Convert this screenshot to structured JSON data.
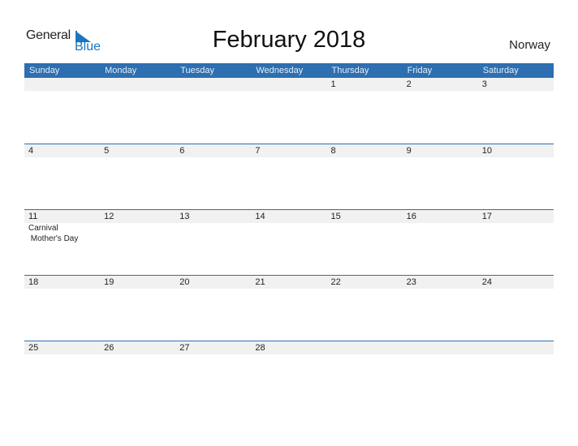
{
  "logo": {
    "general": "General",
    "blue": "Blue"
  },
  "title": "February 2018",
  "country": "Norway",
  "colors": {
    "accent": "#2d6fb0",
    "strip": "#f1f1f1",
    "logo_blue": "#1a76c2"
  },
  "weekdays": [
    "Sunday",
    "Monday",
    "Tuesday",
    "Wednesday",
    "Thursday",
    "Friday",
    "Saturday"
  ],
  "weeks": [
    {
      "days": [
        {
          "date": "",
          "events": []
        },
        {
          "date": "",
          "events": []
        },
        {
          "date": "",
          "events": []
        },
        {
          "date": "",
          "events": []
        },
        {
          "date": "1",
          "events": []
        },
        {
          "date": "2",
          "events": []
        },
        {
          "date": "3",
          "events": []
        }
      ]
    },
    {
      "days": [
        {
          "date": "4",
          "events": []
        },
        {
          "date": "5",
          "events": []
        },
        {
          "date": "6",
          "events": []
        },
        {
          "date": "7",
          "events": []
        },
        {
          "date": "8",
          "events": []
        },
        {
          "date": "9",
          "events": []
        },
        {
          "date": "10",
          "events": []
        }
      ]
    },
    {
      "days": [
        {
          "date": "11",
          "events": [
            "Carnival",
            " Mother's Day"
          ]
        },
        {
          "date": "12",
          "events": []
        },
        {
          "date": "13",
          "events": []
        },
        {
          "date": "14",
          "events": []
        },
        {
          "date": "15",
          "events": []
        },
        {
          "date": "16",
          "events": []
        },
        {
          "date": "17",
          "events": []
        }
      ]
    },
    {
      "days": [
        {
          "date": "18",
          "events": []
        },
        {
          "date": "19",
          "events": []
        },
        {
          "date": "20",
          "events": []
        },
        {
          "date": "21",
          "events": []
        },
        {
          "date": "22",
          "events": []
        },
        {
          "date": "23",
          "events": []
        },
        {
          "date": "24",
          "events": []
        }
      ]
    },
    {
      "days": [
        {
          "date": "25",
          "events": []
        },
        {
          "date": "26",
          "events": []
        },
        {
          "date": "27",
          "events": []
        },
        {
          "date": "28",
          "events": []
        },
        {
          "date": "",
          "events": []
        },
        {
          "date": "",
          "events": []
        },
        {
          "date": "",
          "events": []
        }
      ]
    }
  ]
}
